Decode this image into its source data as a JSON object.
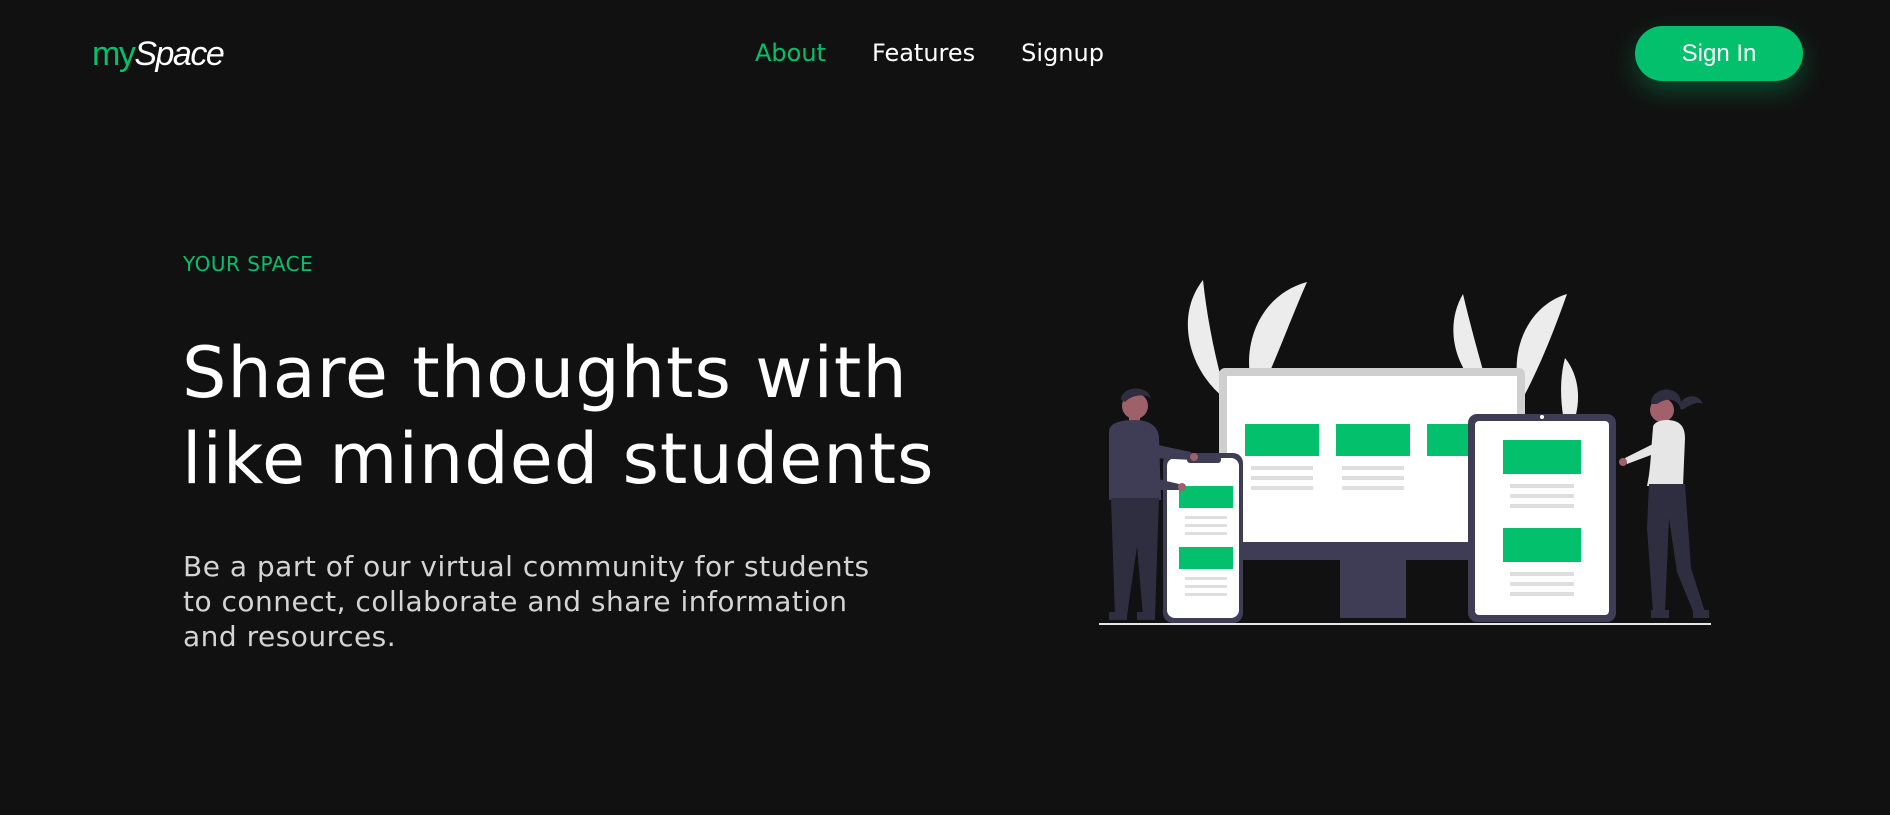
{
  "header": {
    "logo": {
      "part1": "my",
      "part2": "Space"
    },
    "nav": [
      {
        "label": "About",
        "active": true
      },
      {
        "label": "Features",
        "active": false
      },
      {
        "label": "Signup",
        "active": false
      }
    ],
    "signin_label": "Sign In"
  },
  "hero": {
    "eyebrow": "YOUR SPACE",
    "headline_lines": [
      "Share thoughts with",
      "like minded students"
    ],
    "description_lines": [
      "Be a part of our virtual community for students",
      "to connect, collaborate and share information",
      "and resources."
    ]
  },
  "colors": {
    "background": "#111111",
    "accent": "#02c06b",
    "text": "#ffffff",
    "muted_text": "#d4d4d4"
  },
  "illustration": {
    "name": "people-with-devices-illustration"
  }
}
